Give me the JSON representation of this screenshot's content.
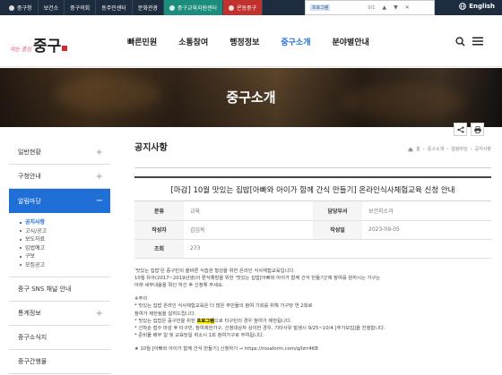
{
  "topbar": {
    "items": [
      "중구청",
      "보건소",
      "중구의회",
      "동주민센터",
      "문화관광",
      "중구교육지원센터",
      "온동중구"
    ],
    "english": "English"
  },
  "findbar": {
    "query": "프로그램",
    "count": "0/1"
  },
  "logo": {
    "small": "여는 중심",
    "big": "중구"
  },
  "gnb": [
    "빠른민원",
    "소통참여",
    "행정정보",
    "중구소개",
    "분야별안내"
  ],
  "hero": {
    "title": "중구소개"
  },
  "sidebar": {
    "items": [
      {
        "label": "일반현황"
      },
      {
        "label": "구청안내"
      },
      {
        "label": "알림마당"
      },
      {
        "label": "중구 SNS 채널 안내"
      },
      {
        "label": "통계정보"
      },
      {
        "label": "중구소식지"
      },
      {
        "label": "중구간행물"
      }
    ],
    "submenu": [
      "공지사항",
      "고시/공고",
      "보도자료",
      "입법예고",
      "구보",
      "모집공고"
    ]
  },
  "content": {
    "page_title": "공지사항",
    "breadcrumb": [
      "홈",
      "중구소개",
      "알림마당",
      "공지사항"
    ],
    "post_title": "[마감] 10월 맛있는 집밥[아빠와 아이가 함께 간식 만들기] 온라인식사체험교육 신청 안내",
    "meta": {
      "row1": {
        "l1": "분류",
        "v1": "교육",
        "l2": "담당부서",
        "v2": "보건지소과"
      },
      "row2": {
        "l1": "작성자",
        "v1": "김임옥",
        "l2": "작성일",
        "v2": "2023-09-05"
      },
      "row3": {
        "l1": "조회",
        "v1": "273"
      }
    },
    "body": {
      "p1": "'맛있는 집밥'은 중구민의 올바른 식습관 형성을 위한 온라인 식사체험교육입니다.",
      "p2": "10월 유아(2017~2019년생)의 편식예방을 위한 '맛있는 집밥[아빠와 아이가 함께 간식 만들기]'에 참여를 원하시는 가구는",
      "p3": "아래 세부내용을 확인 하신 후 신청해 주세요.",
      "note_head": "※주의",
      "n1": "* 맛있는 집밥 온라인 식사체험교육은 더 많은 주민들의 참여 기회를 위해 가구당 연 2회로",
      "n1b": "  참여가 제한됨을 알려드립니다.",
      "n2_pre": "* 맛있는 집밥은 중구민을 위한 ",
      "n2_hl": "프로그램",
      "n2_post": "으로 타구민의 경우 참여가 제한됩니다.",
      "n3": "* 선착순 접수 마감 후 타구민, 참여제한가구, 신청대상자 상이한 경우, 기타사유 발생시 9/25~10/4 [추가모집]을 진행합니다.",
      "n4": "* 준비물 배부 일 및 교육당일 취소시 1회 참여가구로 부여됩니다.",
      "last": "★ 10월 [아빠와 아이가 함께 간식 만들기] 신청하기 → https://moaform.com/q/Izrr4KB"
    }
  }
}
